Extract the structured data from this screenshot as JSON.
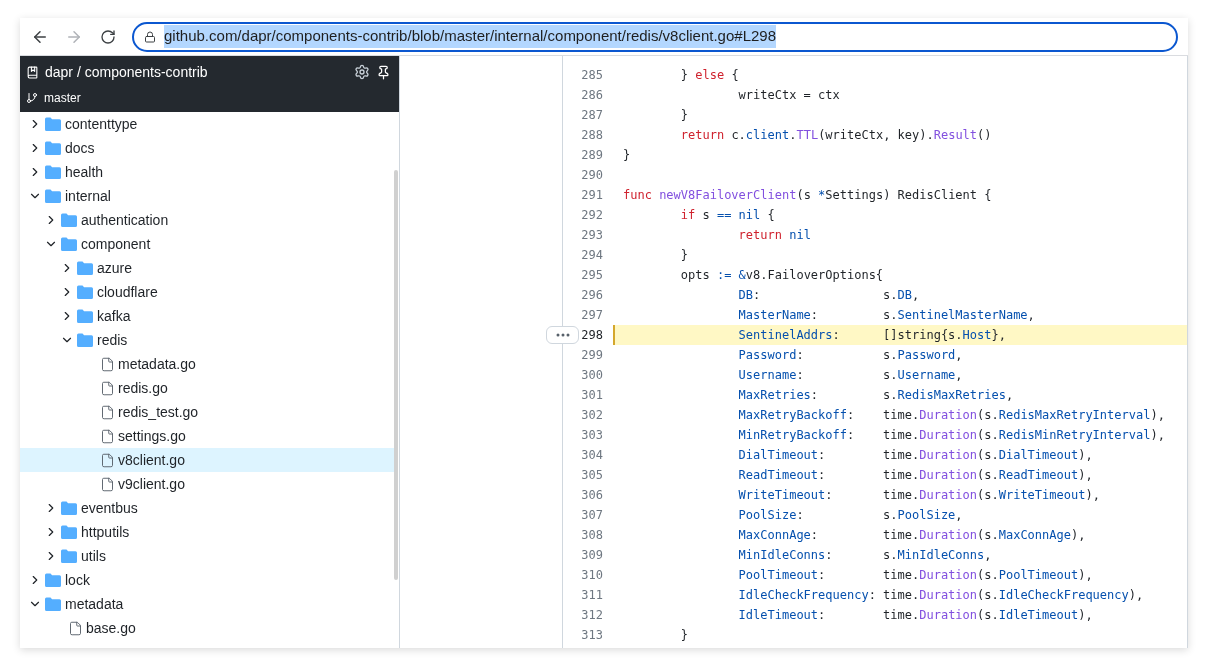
{
  "toolbar": {
    "url": "github.com/dapr/components-contrib/blob/master/internal/component/redis/v8client.go#L298",
    "url_selected": true,
    "forward_disabled": true
  },
  "sidebar": {
    "repo": "dapr / components-contrib",
    "branch": "master",
    "tree": [
      {
        "kind": "folder",
        "name": "contenttype",
        "expanded": false,
        "selected": false
      },
      {
        "kind": "folder",
        "name": "docs",
        "expanded": false,
        "selected": false
      },
      {
        "kind": "folder",
        "name": "health",
        "expanded": false,
        "selected": false
      },
      {
        "kind": "folder",
        "name": "internal",
        "expanded": true,
        "selected": false,
        "children": [
          {
            "kind": "folder",
            "name": "authentication",
            "expanded": false,
            "selected": false
          },
          {
            "kind": "folder",
            "name": "component",
            "expanded": true,
            "selected": false,
            "children": [
              {
                "kind": "folder",
                "name": "azure",
                "expanded": false,
                "selected": false
              },
              {
                "kind": "folder",
                "name": "cloudflare",
                "expanded": false,
                "selected": false
              },
              {
                "kind": "folder",
                "name": "kafka",
                "expanded": false,
                "selected": false
              },
              {
                "kind": "folder",
                "name": "redis",
                "expanded": true,
                "selected": false,
                "children": [
                  {
                    "kind": "file",
                    "name": "metadata.go",
                    "selected": false
                  },
                  {
                    "kind": "file",
                    "name": "redis.go",
                    "selected": false
                  },
                  {
                    "kind": "file",
                    "name": "redis_test.go",
                    "selected": false
                  },
                  {
                    "kind": "file",
                    "name": "settings.go",
                    "selected": false
                  },
                  {
                    "kind": "file",
                    "name": "v8client.go",
                    "selected": true
                  },
                  {
                    "kind": "file",
                    "name": "v9client.go",
                    "selected": false
                  }
                ]
              }
            ]
          },
          {
            "kind": "folder",
            "name": "eventbus",
            "expanded": false,
            "selected": false
          },
          {
            "kind": "folder",
            "name": "httputils",
            "expanded": false,
            "selected": false
          },
          {
            "kind": "folder",
            "name": "utils",
            "expanded": false,
            "selected": false
          }
        ]
      },
      {
        "kind": "folder",
        "name": "lock",
        "expanded": false,
        "selected": false
      },
      {
        "kind": "folder",
        "name": "metadata",
        "expanded": true,
        "selected": false,
        "children": [
          {
            "kind": "file",
            "name": "base.go",
            "selected": false
          }
        ]
      }
    ]
  },
  "code": {
    "lines": [
      {
        "number": "285",
        "selected": false,
        "tokens": [
          {
            "kind": "plain",
            "text": "        } "
          },
          {
            "kind": "keyword",
            "text": "else"
          },
          {
            "kind": "plain",
            "text": " {"
          }
        ]
      },
      {
        "number": "286",
        "selected": false,
        "tokens": [
          {
            "kind": "plain",
            "text": "                writeCtx = ctx"
          }
        ]
      },
      {
        "number": "287",
        "selected": false,
        "tokens": [
          {
            "kind": "plain",
            "text": "        }"
          }
        ]
      },
      {
        "number": "288",
        "selected": false,
        "tokens": [
          {
            "kind": "keyword",
            "text": "        return"
          },
          {
            "kind": "plain",
            "text": " c."
          },
          {
            "kind": "property",
            "text": "client"
          },
          {
            "kind": "plain",
            "text": "."
          },
          {
            "kind": "function",
            "text": "TTL"
          },
          {
            "kind": "plain",
            "text": "(writeCtx, key)."
          },
          {
            "kind": "function",
            "text": "Result"
          },
          {
            "kind": "plain",
            "text": "()"
          }
        ]
      },
      {
        "number": "289",
        "selected": false,
        "tokens": [
          {
            "kind": "plain",
            "text": "}"
          }
        ]
      },
      {
        "number": "290",
        "selected": false
      },
      {
        "number": "291",
        "selected": false,
        "tokens": [
          {
            "kind": "keyword",
            "text": "func "
          },
          {
            "kind": "function",
            "text": "newV8FailoverClient"
          },
          {
            "kind": "plain",
            "text": "(s "
          },
          {
            "kind": "operator",
            "text": "*"
          },
          {
            "kind": "plain",
            "text": "Settings) RedisClient {"
          }
        ]
      },
      {
        "number": "292",
        "selected": false,
        "tokens": [
          {
            "kind": "keyword",
            "text": "        if"
          },
          {
            "kind": "plain",
            "text": " s "
          },
          {
            "kind": "operator",
            "text": "=="
          },
          {
            "kind": "property",
            "text": " nil"
          },
          {
            "kind": "plain",
            "text": " {"
          }
        ]
      },
      {
        "number": "293",
        "selected": false,
        "tokens": [
          {
            "kind": "keyword",
            "text": "                return"
          },
          {
            "kind": "property",
            "text": " nil"
          }
        ]
      },
      {
        "number": "294",
        "selected": false,
        "tokens": [
          {
            "kind": "plain",
            "text": "        }"
          }
        ]
      },
      {
        "number": "295",
        "selected": false,
        "tokens": [
          {
            "kind": "plain",
            "text": "        opts "
          },
          {
            "kind": "operator",
            "text": ":="
          },
          {
            "kind": "operator",
            "text": " &"
          },
          {
            "kind": "plain",
            "text": "v8.FailoverOptions{"
          }
        ]
      },
      {
        "number": "296",
        "selected": false,
        "tokens": [
          {
            "kind": "property",
            "text": "                DB"
          },
          {
            "kind": "plain",
            "text": ":                 s."
          },
          {
            "kind": "property",
            "text": "DB"
          },
          {
            "kind": "plain",
            "text": ","
          }
        ]
      },
      {
        "number": "297",
        "selected": false,
        "tokens": [
          {
            "kind": "property",
            "text": "                MasterName"
          },
          {
            "kind": "plain",
            "text": ":         s."
          },
          {
            "kind": "property",
            "text": "SentinelMasterName"
          },
          {
            "kind": "plain",
            "text": ","
          }
        ]
      },
      {
        "number": "298",
        "selected": true,
        "tokens": [
          {
            "kind": "property",
            "text": "                SentinelAddrs"
          },
          {
            "kind": "plain",
            "text": ":      []string{s."
          },
          {
            "kind": "property",
            "text": "Host"
          },
          {
            "kind": "plain",
            "text": "},"
          }
        ]
      },
      {
        "number": "299",
        "selected": false,
        "tokens": [
          {
            "kind": "property",
            "text": "                Password"
          },
          {
            "kind": "plain",
            "text": ":           s."
          },
          {
            "kind": "property",
            "text": "Password"
          },
          {
            "kind": "plain",
            "text": ","
          }
        ]
      },
      {
        "number": "300",
        "selected": false,
        "tokens": [
          {
            "kind": "property",
            "text": "                Username"
          },
          {
            "kind": "plain",
            "text": ":           s."
          },
          {
            "kind": "property",
            "text": "Username"
          },
          {
            "kind": "plain",
            "text": ","
          }
        ]
      },
      {
        "number": "301",
        "selected": false,
        "tokens": [
          {
            "kind": "property",
            "text": "                MaxRetries"
          },
          {
            "kind": "plain",
            "text": ":         s."
          },
          {
            "kind": "property",
            "text": "RedisMaxRetries"
          },
          {
            "kind": "plain",
            "text": ","
          }
        ]
      },
      {
        "number": "302",
        "selected": false,
        "tokens": [
          {
            "kind": "property",
            "text": "                MaxRetryBackoff"
          },
          {
            "kind": "plain",
            "text": ":    time."
          },
          {
            "kind": "function",
            "text": "Duration"
          },
          {
            "kind": "plain",
            "text": "(s."
          },
          {
            "kind": "property",
            "text": "RedisMaxRetryInterval"
          },
          {
            "kind": "plain",
            "text": "),"
          }
        ]
      },
      {
        "number": "303",
        "selected": false,
        "tokens": [
          {
            "kind": "property",
            "text": "                MinRetryBackoff"
          },
          {
            "kind": "plain",
            "text": ":    time."
          },
          {
            "kind": "function",
            "text": "Duration"
          },
          {
            "kind": "plain",
            "text": "(s."
          },
          {
            "kind": "property",
            "text": "RedisMinRetryInterval"
          },
          {
            "kind": "plain",
            "text": "),"
          }
        ]
      },
      {
        "number": "304",
        "selected": false,
        "tokens": [
          {
            "kind": "property",
            "text": "                DialTimeout"
          },
          {
            "kind": "plain",
            "text": ":        time."
          },
          {
            "kind": "function",
            "text": "Duration"
          },
          {
            "kind": "plain",
            "text": "(s."
          },
          {
            "kind": "property",
            "text": "DialTimeout"
          },
          {
            "kind": "plain",
            "text": "),"
          }
        ]
      },
      {
        "number": "305",
        "selected": false,
        "tokens": [
          {
            "kind": "property",
            "text": "                ReadTimeout"
          },
          {
            "kind": "plain",
            "text": ":        time."
          },
          {
            "kind": "function",
            "text": "Duration"
          },
          {
            "kind": "plain",
            "text": "(s."
          },
          {
            "kind": "property",
            "text": "ReadTimeout"
          },
          {
            "kind": "plain",
            "text": "),"
          }
        ]
      },
      {
        "number": "306",
        "selected": false,
        "tokens": [
          {
            "kind": "property",
            "text": "                WriteTimeout"
          },
          {
            "kind": "plain",
            "text": ":       time."
          },
          {
            "kind": "function",
            "text": "Duration"
          },
          {
            "kind": "plain",
            "text": "(s."
          },
          {
            "kind": "property",
            "text": "WriteTimeout"
          },
          {
            "kind": "plain",
            "text": "),"
          }
        ]
      },
      {
        "number": "307",
        "selected": false,
        "tokens": [
          {
            "kind": "property",
            "text": "                PoolSize"
          },
          {
            "kind": "plain",
            "text": ":           s."
          },
          {
            "kind": "property",
            "text": "PoolSize"
          },
          {
            "kind": "plain",
            "text": ","
          }
        ]
      },
      {
        "number": "308",
        "selected": false,
        "tokens": [
          {
            "kind": "property",
            "text": "                MaxConnAge"
          },
          {
            "kind": "plain",
            "text": ":         time."
          },
          {
            "kind": "function",
            "text": "Duration"
          },
          {
            "kind": "plain",
            "text": "(s."
          },
          {
            "kind": "property",
            "text": "MaxConnAge"
          },
          {
            "kind": "plain",
            "text": "),"
          }
        ]
      },
      {
        "number": "309",
        "selected": false,
        "tokens": [
          {
            "kind": "property",
            "text": "                MinIdleConns"
          },
          {
            "kind": "plain",
            "text": ":       s."
          },
          {
            "kind": "property",
            "text": "MinIdleConns"
          },
          {
            "kind": "plain",
            "text": ","
          }
        ]
      },
      {
        "number": "310",
        "selected": false,
        "tokens": [
          {
            "kind": "property",
            "text": "                PoolTimeout"
          },
          {
            "kind": "plain",
            "text": ":        time."
          },
          {
            "kind": "function",
            "text": "Duration"
          },
          {
            "kind": "plain",
            "text": "(s."
          },
          {
            "kind": "property",
            "text": "PoolTimeout"
          },
          {
            "kind": "plain",
            "text": "),"
          }
        ]
      },
      {
        "number": "311",
        "selected": false,
        "tokens": [
          {
            "kind": "property",
            "text": "                IdleCheckFrequency"
          },
          {
            "kind": "plain",
            "text": ": time."
          },
          {
            "kind": "function",
            "text": "Duration"
          },
          {
            "kind": "plain",
            "text": "(s."
          },
          {
            "kind": "property",
            "text": "IdleCheckFrequency"
          },
          {
            "kind": "plain",
            "text": "),"
          }
        ]
      },
      {
        "number": "312",
        "selected": false,
        "tokens": [
          {
            "kind": "property",
            "text": "                IdleTimeout"
          },
          {
            "kind": "plain",
            "text": ":        time."
          },
          {
            "kind": "function",
            "text": "Duration"
          },
          {
            "kind": "plain",
            "text": "(s."
          },
          {
            "kind": "property",
            "text": "IdleTimeout"
          },
          {
            "kind": "plain",
            "text": "),"
          }
        ]
      },
      {
        "number": "313",
        "selected": false,
        "tokens": [
          {
            "kind": "plain",
            "text": "        }"
          }
        ]
      }
    ]
  }
}
